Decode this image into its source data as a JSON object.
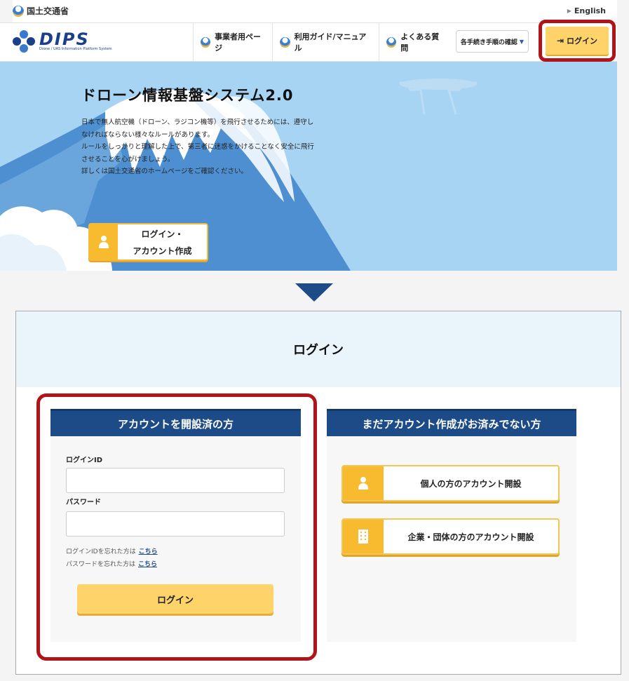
{
  "topbar": {
    "ministry": "国土交通省",
    "english": "English"
  },
  "header": {
    "logo_text": "DIPS",
    "logo_sub": "Drone / UAS Information Platform System",
    "nav": [
      "事業者用ページ",
      "利用ガイド/マニュアル",
      "よくある質問"
    ],
    "procedures": "各手続き手順の確認",
    "login": "ログイン"
  },
  "hero": {
    "title": "ドローン情報基盤システム2.0",
    "lines": [
      "日本で無人航空機（ドローン、ラジコン機等）を飛行させるためには、遵守し",
      "なければならない様々なルールがあります。",
      "ルールをしっかりと理解した上で、第三者に迷惑をかけることなく安全に飛行",
      "させることを心がけましょう。",
      "詳しくは国土交通省のホームページをご確認ください。"
    ],
    "button_line1": "ログイン・",
    "button_line2": "アカウント作成"
  },
  "login_panel": {
    "title": "ログイン",
    "left": {
      "heading": "アカウントを開設済の方",
      "id_label": "ログインID",
      "id_value": "",
      "password_label": "パスワード",
      "password_value": "",
      "forgot_id_text": "ログインIDを忘れた方は",
      "forgot_pw_text": "パスワードを忘れた方は",
      "link_text": "こちら",
      "submit": "ログイン"
    },
    "right": {
      "heading": "まだアカウント作成がお済みでない方",
      "personal": "個人の方のアカウント開設",
      "corporate": "企業・団体の方のアカウント開設"
    }
  },
  "colors": {
    "navy": "#1d4b87",
    "yellow": "#fdd36a",
    "highlight": "#b0141a"
  }
}
